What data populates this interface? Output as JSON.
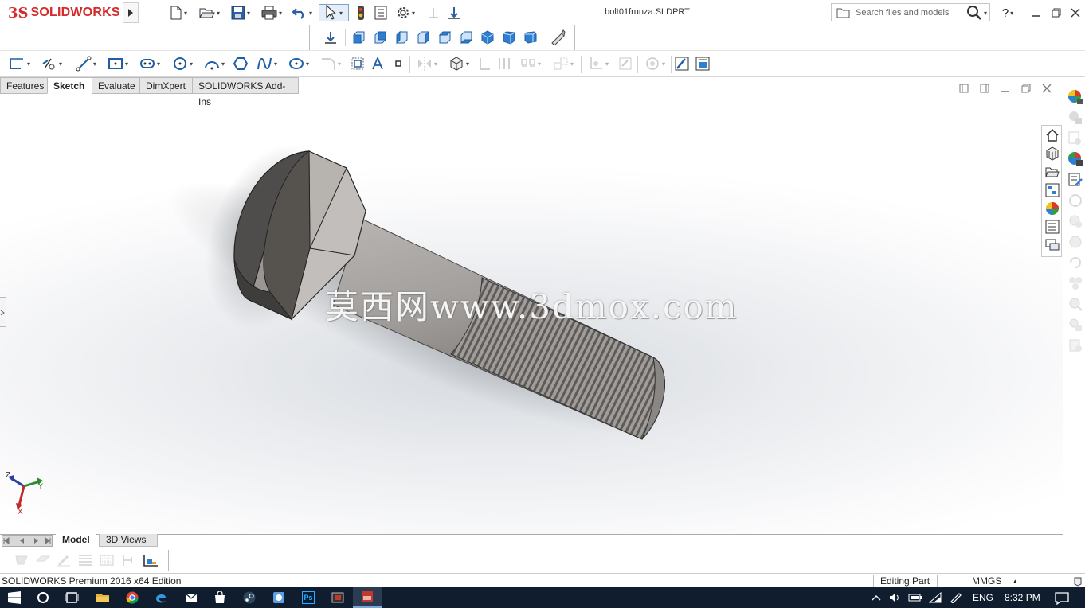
{
  "app": {
    "brand_prefix": "3S",
    "brand_name": "SOLIDWORKS",
    "document_title": "bolt01frunza.SLDPRT",
    "search_placeholder": "Search files and models",
    "help_label": "?"
  },
  "toolbar_icons": [
    "new-document-icon",
    "open-folder-icon",
    "save-icon",
    "print-icon",
    "undo-icon",
    "select-cursor-icon",
    "rebuild-icon",
    "file-properties-icon",
    "options-gear-icon"
  ],
  "view_toolbar_icons": [
    "normal-to-icon",
    "view-front-icon",
    "view-back-icon",
    "view-left-icon",
    "view-right-icon",
    "view-top-icon",
    "view-bottom-icon",
    "view-isometric-icon",
    "view-trimetric-icon",
    "measure-tool-icon"
  ],
  "sketch_tools": [
    "sketch-icon",
    "smart-dimension-icon",
    "line-icon",
    "rectangle-icon",
    "slot-icon",
    "circle-icon",
    "arc-icon",
    "polygon-icon",
    "spline-icon",
    "ellipse-icon",
    "fillet-icon",
    "offset-icon",
    "text-icon",
    "point-icon",
    "mirror-icon",
    "convert-entities-icon",
    "trim-icon",
    "linear-pattern-icon",
    "move-entities-icon",
    "display-relations-icon",
    "repair-sketch-icon",
    "quick-snaps-icon",
    "rapid-sketch-icon",
    "instant2d-icon"
  ],
  "tabs": [
    {
      "label": "Features",
      "active": false
    },
    {
      "label": "Sketch",
      "active": true
    },
    {
      "label": "Evaluate",
      "active": false
    },
    {
      "label": "DimXpert",
      "active": false
    },
    {
      "label": "SOLIDWORKS Add-Ins",
      "active": false
    }
  ],
  "watermark": "莫西网www.3dmox.com",
  "triad": {
    "z": "Z",
    "x": "X",
    "y": "Y"
  },
  "view_palette": [
    "home-icon",
    "3d-part-icon",
    "open-folder-icon",
    "design-library-icon",
    "appearances-icon",
    "file-explorer-icon",
    "forum-icon"
  ],
  "model_tabs": [
    {
      "label": "Model",
      "active": true
    },
    {
      "label": "3D Views",
      "active": false
    }
  ],
  "status": {
    "edition": "SOLIDWORKS Premium 2016 x64 Edition",
    "mode": "Editing Part",
    "units": "MMGS"
  },
  "taskbar": {
    "apps": [
      "windows-start-icon",
      "cortana-search-icon",
      "task-view-icon",
      "file-explorer-icon",
      "chrome-icon",
      "edge-icon",
      "mail-icon",
      "store-icon",
      "steam-icon",
      "app-icon",
      "photoshop-icon",
      "media-icon",
      "solidworks-icon"
    ],
    "photoshop_label": "Ps",
    "language": "ENG",
    "time": "8:32 PM"
  },
  "colors": {
    "brand_red": "#d42b2b",
    "taskbar_bg": "#0f1d2f",
    "bolt_gray": "#8e8a87"
  }
}
